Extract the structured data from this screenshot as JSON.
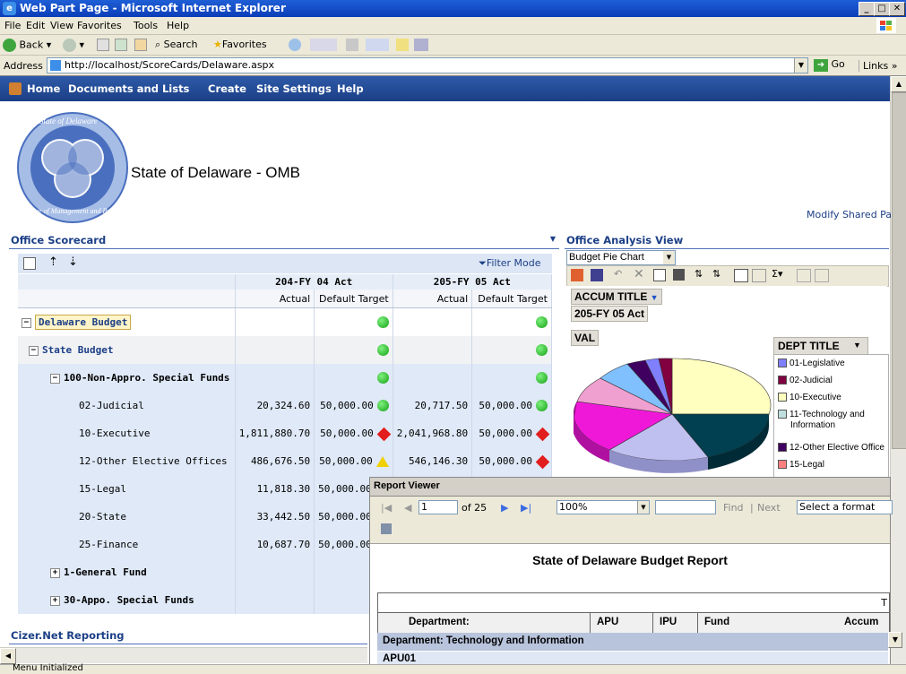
{
  "window": {
    "title": "Web Part Page - Microsoft Internet Explorer"
  },
  "menu": [
    "File",
    "Edit",
    "View",
    "Favorites",
    "Tools",
    "Help"
  ],
  "toolbar": {
    "back": "Back",
    "search": "Search",
    "favorites": "Favorites"
  },
  "address": {
    "label": "Address",
    "url": "http://localhost/ScoreCards/Delaware.aspx",
    "go": "Go",
    "links": "Links"
  },
  "nav": [
    "Home",
    "Documents and Lists",
    "Create",
    "Site Settings",
    "Help"
  ],
  "site": {
    "title": "State of Delaware - OMB",
    "modify": "Modify Shared Pa",
    "logo_top": "State of Delaware",
    "logo_bottom": "Office of Management and Budget"
  },
  "scorecard": {
    "title": "Office Scorecard",
    "filter_mode": "Filter Mode",
    "col_groups": [
      "204-FY 04 Act",
      "205-FY 05 Act"
    ],
    "col_heads": [
      "Actual",
      "Default Target",
      "Actual",
      "Default Target"
    ],
    "rows": [
      {
        "label": "Delaware Budget",
        "a1": "",
        "t1": "",
        "a2": "",
        "t2": ""
      },
      {
        "label": "State Budget",
        "a1": "",
        "t1": "",
        "a2": "",
        "t2": ""
      },
      {
        "label": "100-Non-Appro. Special Funds",
        "a1": "",
        "t1": "",
        "a2": "",
        "t2": ""
      },
      {
        "label": "02-Judicial",
        "a1": "20,324.60",
        "t1": "50,000.00",
        "a2": "20,717.50",
        "t2": "50,000.00"
      },
      {
        "label": "10-Executive",
        "a1": "1,811,880.70",
        "t1": "50,000.00",
        "a2": "2,041,968.80",
        "t2": "50,000.00"
      },
      {
        "label": "12-Other Elective Offices",
        "a1": "486,676.50",
        "t1": "50,000.00",
        "a2": "546,146.30",
        "t2": "50,000.00"
      },
      {
        "label": "15-Legal",
        "a1": "11,818.30",
        "t1": "50,000.00"
      },
      {
        "label": "20-State",
        "a1": "33,442.50",
        "t1": "50,000.00"
      },
      {
        "label": "25-Finance",
        "a1": "10,687.70",
        "t1": "50,000.00"
      },
      {
        "label": "1-General Fund"
      },
      {
        "label": "30-Appo. Special Funds"
      }
    ],
    "status": {
      "green": "#1aab1a",
      "red": "#e21d1d",
      "yellow": "#f0d000"
    }
  },
  "cizer": {
    "title": "Cizer.Net Reporting"
  },
  "analysis": {
    "title": "Office Analysis View",
    "view_select": "Budget Pie Chart",
    "accum_title": "ACCUM TITLE",
    "accum_value": "205-FY 05 Act",
    "val": "VAL",
    "dept_title": "DEPT TITLE",
    "legend": [
      {
        "label": "01-Legislative",
        "color": "#8080ff"
      },
      {
        "label": "02-Judicial",
        "color": "#800040"
      },
      {
        "label": "10-Executive",
        "color": "#ffffc0"
      },
      {
        "label": "11-Technology and Information",
        "color": "#c0e0e0"
      },
      {
        "label": "12-Other Elective Office",
        "color": "#400060"
      },
      {
        "label": "15-Legal",
        "color": "#ff8080"
      }
    ]
  },
  "report": {
    "title": "Report Viewer",
    "page": "1",
    "of": "of 25",
    "zoom": "100%",
    "find": "Find",
    "next": "Next",
    "format": "Select a format",
    "heading": "State of Delaware Budget Report",
    "trunc": "T",
    "columns": [
      "Department:",
      "APU",
      "IPU",
      "Fund",
      "Accum"
    ],
    "group": "Department: Technology and Information",
    "sub": "APU01"
  },
  "statusbar": {
    "text": "Menu Initialized"
  }
}
